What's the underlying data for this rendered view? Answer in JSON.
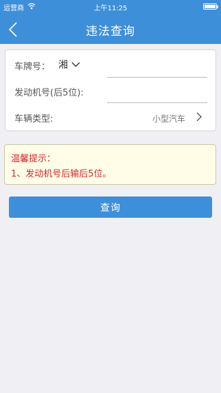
{
  "status_bar": {
    "carrier": "运营商",
    "time": "上午11:25"
  },
  "nav": {
    "title": "违法查询"
  },
  "form": {
    "plate_label": "车牌号：",
    "plate_prefix": "湘",
    "plate_value": "",
    "engine_label": "发动机号(后5位):",
    "engine_value": "",
    "vehicle_type_label": "车辆类型:",
    "vehicle_type_value": "小型汽车"
  },
  "tips": {
    "title": "温馨提示：",
    "line1": "1、发动机号后输后5位。"
  },
  "actions": {
    "query_label": "查询"
  },
  "colors": {
    "nav": "#3e8fd9",
    "button": "#3e8fd9",
    "tip_text": "#d42a2a",
    "tip_bg": "#fffde8"
  }
}
